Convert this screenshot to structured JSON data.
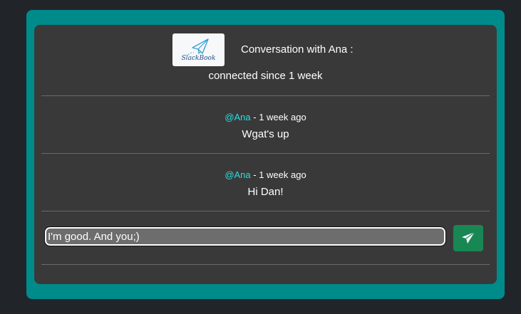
{
  "header": {
    "logo_text": "SlackBook",
    "title": "Conversation with Ana :",
    "status": "connected since 1 week"
  },
  "messages": [
    {
      "author": "@Ana",
      "time": " - 1 week ago",
      "text": "Wgat's up"
    },
    {
      "author": "@Ana",
      "time": " - 1 week ago",
      "text": "Hi Dan!"
    }
  ],
  "composer": {
    "value": "I'm good. And you;)",
    "send_icon": "paper-plane-icon"
  },
  "colors": {
    "page_background": "#212529",
    "frame": "#008b8b",
    "card": "#3a3939",
    "author": "#29e0e0",
    "send_button": "#198754"
  }
}
